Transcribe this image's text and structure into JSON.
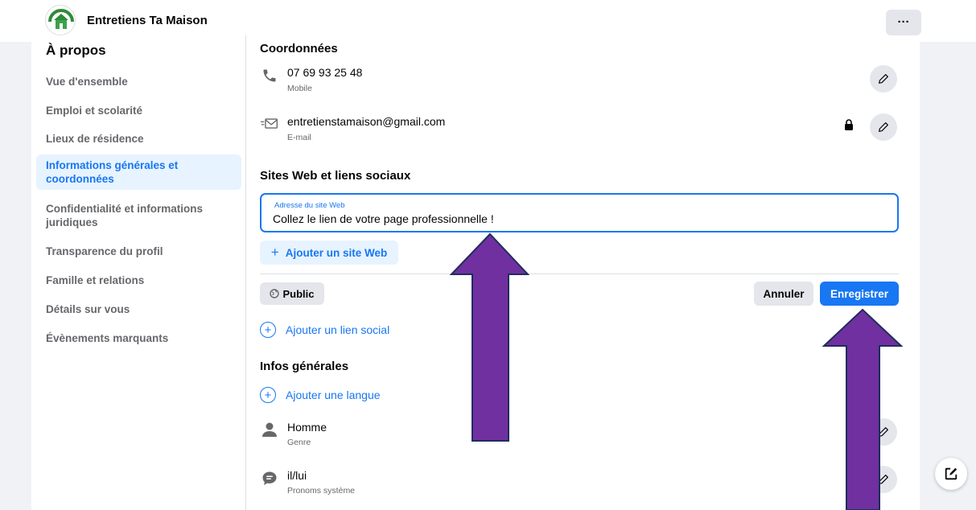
{
  "header": {
    "page_name": "Entretiens Ta Maison",
    "more_label": "···",
    "logo_icon": "brand-logo-icon"
  },
  "sidebar": {
    "title": "À propos",
    "items": [
      {
        "label": "Vue d'ensemble",
        "active": false
      },
      {
        "label": "Emploi et scolarité",
        "active": false
      },
      {
        "label": "Lieux de résidence",
        "active": false
      },
      {
        "label": "Informations générales et coordonnées",
        "active": true
      },
      {
        "label": "Confidentialité et informations juridiques",
        "active": false
      },
      {
        "label": "Transparence du profil",
        "active": false
      },
      {
        "label": "Famille et relations",
        "active": false
      },
      {
        "label": "Détails sur vous",
        "active": false
      },
      {
        "label": "Évènements marquants",
        "active": false
      }
    ]
  },
  "contact": {
    "title": "Coordonnées",
    "phone": {
      "value": "07 69 93 25 48",
      "type": "Mobile",
      "icon": "phone-icon"
    },
    "email": {
      "value": "entretienstamaison@gmail.com",
      "type": "E-mail",
      "icon": "envelope-icon",
      "privacy_icon": "lock-icon"
    }
  },
  "websites": {
    "title": "Sites Web et liens sociaux",
    "input_label": "Adresse du site Web",
    "input_value": "Collez le lien de votre page professionnelle !",
    "add_site_label": "Ajouter un site Web",
    "public_label": "Public",
    "cancel_label": "Annuler",
    "save_label": "Enregistrer",
    "add_social_label": "Ajouter un lien social"
  },
  "general": {
    "title": "Infos générales",
    "add_language_label": "Ajouter une langue",
    "gender": {
      "value": "Homme",
      "type": "Genre",
      "icon": "person-icon"
    },
    "pronouns": {
      "value": "il/lui",
      "type": "Pronoms système",
      "icon": "speech-bubble-icon"
    }
  },
  "colors": {
    "accent": "#1877f2",
    "accent_light": "#e7f3ff",
    "annotation_arrow_fill": "#7030a0",
    "annotation_arrow_stroke": "#1f2d5c"
  }
}
